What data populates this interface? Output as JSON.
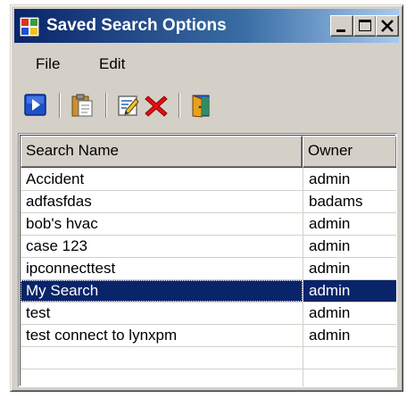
{
  "window": {
    "title": "Saved Search Options",
    "title_gradient": [
      "#0a246a",
      "#a6caf0"
    ],
    "controls": [
      "minimize-icon",
      "maximize-icon",
      "close-icon"
    ]
  },
  "menu": {
    "items": [
      {
        "label": "File"
      },
      {
        "label": "Edit"
      }
    ]
  },
  "toolbar": {
    "tools": [
      "run-icon",
      "clipboard-icon",
      "edit-icon",
      "delete-icon",
      "exit-door-icon"
    ]
  },
  "list": {
    "columns": [
      {
        "label": "Search Name"
      },
      {
        "label": "Owner"
      }
    ],
    "rows": [
      {
        "name": "Accident",
        "owner": "admin"
      },
      {
        "name": "adfasfdas",
        "owner": "badams"
      },
      {
        "name": "bob's hvac",
        "owner": "admin"
      },
      {
        "name": "case 123",
        "owner": "admin"
      },
      {
        "name": "ipconnecttest",
        "owner": "admin"
      },
      {
        "name": "My Search",
        "owner": "admin",
        "selected": true
      },
      {
        "name": "test",
        "owner": "admin"
      },
      {
        "name": "test connect to lynxpm",
        "owner": "admin"
      }
    ],
    "selection_color": "#0a246a"
  }
}
